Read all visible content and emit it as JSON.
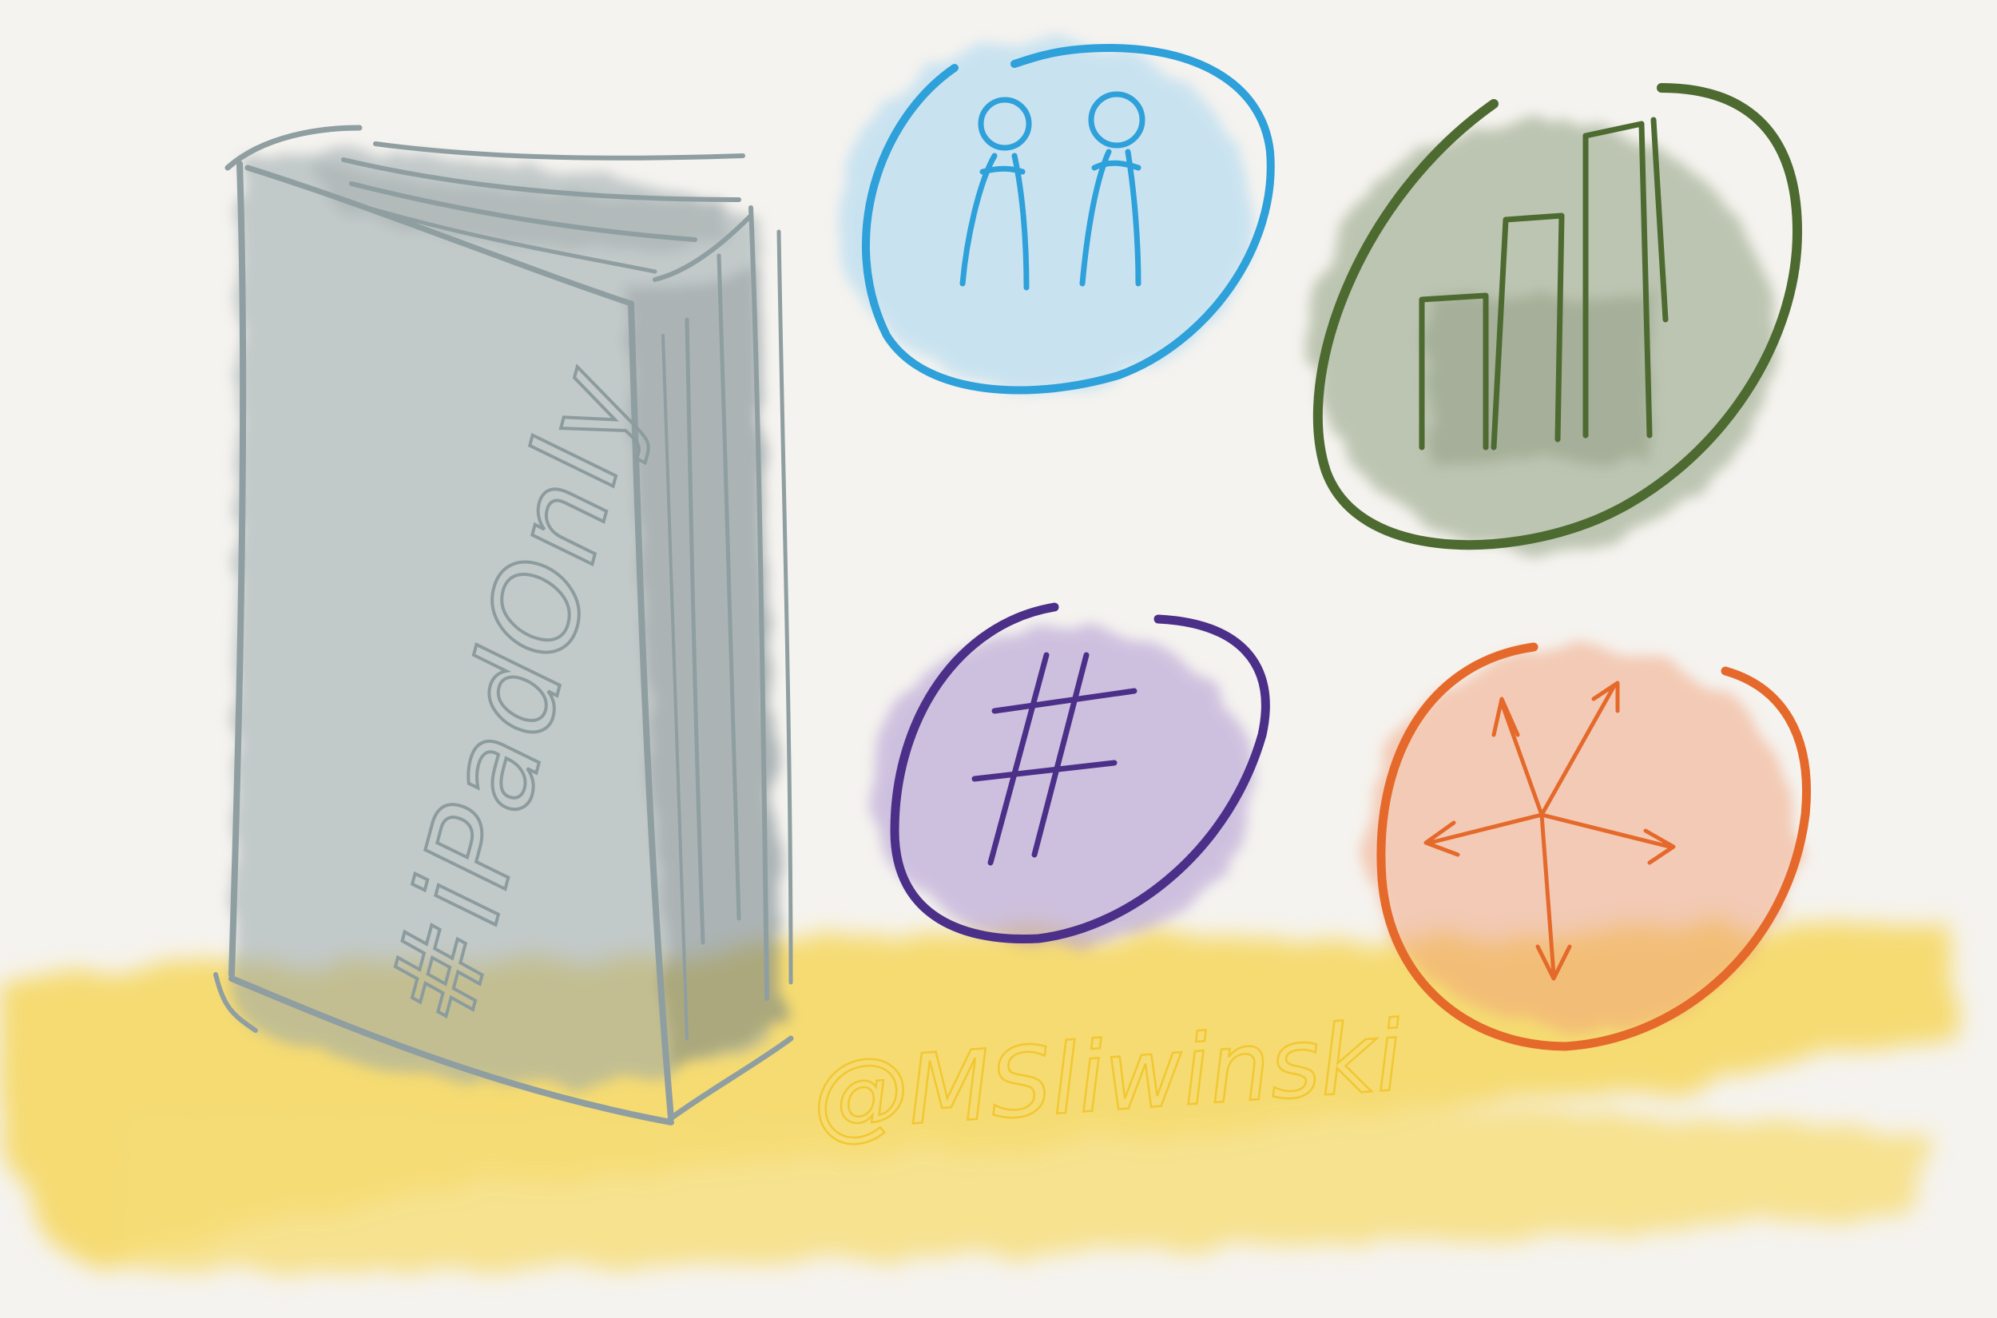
{
  "book": {
    "spine_text": "#iPadOnly"
  },
  "signature": {
    "text": "@MSliwinski"
  },
  "icons": {
    "people": "people-icon",
    "chart": "bar-chart-icon",
    "hashtag": "hashtag-icon",
    "arrows": "expand-arrows-icon"
  },
  "colors": {
    "paper": "#f5f3ef",
    "book": "#8c9a9c",
    "blue": "#2a9fd8",
    "green": "#4e6b33",
    "purple": "#4a2f87",
    "orange": "#e06a2a",
    "yellow": "#f4d03f"
  }
}
